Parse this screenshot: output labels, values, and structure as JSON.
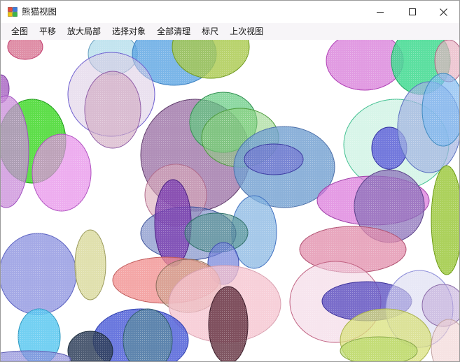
{
  "window": {
    "title": "熊猫视图",
    "icon": "app-icon",
    "controls": [
      "minimize-icon",
      "maximize-icon",
      "close-icon"
    ]
  },
  "menu": {
    "items": [
      "全图",
      "平移",
      "放大局部",
      "选择对象",
      "全部清理",
      "标尺",
      "上次视图"
    ]
  },
  "canvas": {
    "background": "#ffffff",
    "content": "random semi-transparent ellipses"
  }
}
